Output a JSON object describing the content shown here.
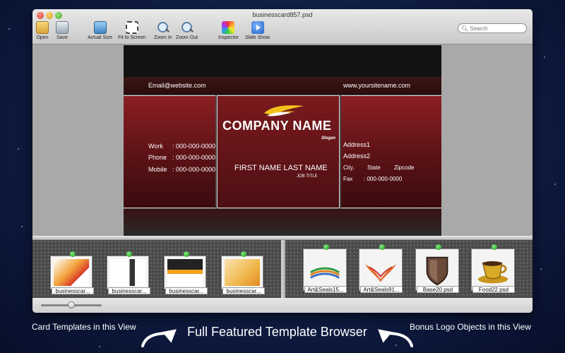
{
  "window": {
    "title": "businesscard857.psd"
  },
  "toolbar": {
    "open": "Open",
    "save": "Save",
    "actual_size": "Actual Size",
    "fit_to_screen": "Fit to Screen",
    "zoom_in": "Zoom In",
    "zoom_out": "Zoom Out",
    "inspector": "Inspector",
    "slide_show": "Slide Show"
  },
  "search": {
    "placeholder": "Search"
  },
  "card": {
    "email": "Email@website.com",
    "website": "www.yoursitename.com",
    "work_label": "Work",
    "work_value": ": 000-000-0000",
    "phone_label": "Phone",
    "phone_value": ": 000-000-0000",
    "mobile_label": "Mobile",
    "mobile_value": ": 000-000-0000",
    "company": "COMPANY NAME",
    "slogan": "Slogan",
    "name": "FIRST NAME LAST NAME",
    "job_title": "JOB TITLE",
    "address1": "Address1",
    "address2": "Address2",
    "city": "City,",
    "state": "State",
    "zipcode": "Zipcode",
    "fax_label": "Fax",
    "fax_value": ": 000-000-0000"
  },
  "templates": [
    {
      "label": "businesscar..."
    },
    {
      "label": "businesscar..."
    },
    {
      "label": "businesscar..."
    },
    {
      "label": "businesscar..."
    }
  ],
  "logos": [
    {
      "label": "Art&Seals15..."
    },
    {
      "label": "Art&Seals91..."
    },
    {
      "label": "Base20.psd"
    },
    {
      "label": "Food22.psd"
    }
  ],
  "thumbnail_size_slider": {
    "value_fraction": 0.5
  },
  "captions": {
    "left": "Card Templates in this View",
    "center": "Full Featured  Template Browser",
    "right": "Bonus Logo Objects in this View"
  },
  "colors": {
    "card_red": "#8b1f23",
    "swoosh": "#f2c21a",
    "background": "#0f1d44"
  }
}
